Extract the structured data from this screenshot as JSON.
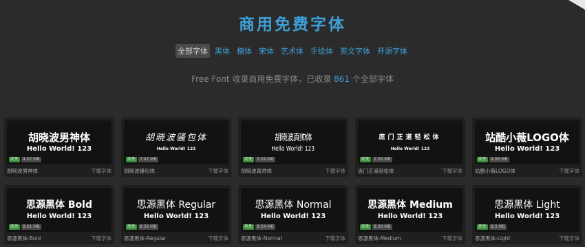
{
  "header": {
    "title": "商用免费字体",
    "tabs": [
      "全部字体",
      "黑体",
      "楷体",
      "宋体",
      "艺术体",
      "手绘体",
      "英文字体",
      "开源字体"
    ],
    "active_tab": "全部字体",
    "subtitle_prefix": "Free Font 收录商用免费字体，已收录 ",
    "subtitle_count": "861",
    "subtitle_suffix": " 个全部字体"
  },
  "cards": [
    {
      "preview": "胡晓波男神体",
      "hello": "Hello World! 123",
      "free": "商免",
      "size": "4.07 MB",
      "name": "胡晓波男神体",
      "download": "下载字体"
    },
    {
      "preview": "胡晓波骚包体",
      "hello": "Hello World! 123",
      "free": "商免",
      "size": "7.47 MB",
      "name": "胡晓波骚包体",
      "download": "下载字体"
    },
    {
      "preview": "胡晓波真帅体",
      "hello": "Hello World! 123",
      "free": "商免",
      "size": "3.24 MB",
      "name": "胡晓波真帅体",
      "download": "下载字体"
    },
    {
      "preview": "庞门正道轻松体",
      "hello": "Hello World! 123",
      "free": "商免",
      "size": "2.26 MB",
      "name": "庞门正道轻松体",
      "download": "下载字体"
    },
    {
      "preview": "站酷小薇LOGO体",
      "hello": "Hello World! 123",
      "free": "商免",
      "size": "4.06 MB",
      "name": "站酷小薇LOGO体",
      "download": "下载字体"
    },
    {
      "preview": "思源黑体 Bold",
      "hello": "Hello World! 123",
      "free": "商免",
      "size": "8.61 MB",
      "name": "思源黑体-Bold",
      "download": "下载字体"
    },
    {
      "preview": "思源黑体 Regular",
      "hello": "Hello World! 123",
      "free": "商免",
      "size": "8.36 MB",
      "name": "思源黑体-Regular",
      "download": "下载字体"
    },
    {
      "preview": "思源黑体 Normal",
      "hello": "Hello World! 123",
      "free": "商免",
      "size": "8.24 MB",
      "name": "思源黑体-Normal",
      "download": "下载字体"
    },
    {
      "preview": "思源黑体 Medium",
      "hello": "Hello World! 123",
      "free": "商免",
      "size": "8.39 MB",
      "name": "思源黑体-Medium",
      "download": "下载字体"
    },
    {
      "preview": "思源黑体 Light",
      "hello": "Hello World! 123",
      "free": "商免",
      "size": "8.3 MB",
      "name": "思源黑体-Light",
      "download": "下载字体"
    }
  ]
}
